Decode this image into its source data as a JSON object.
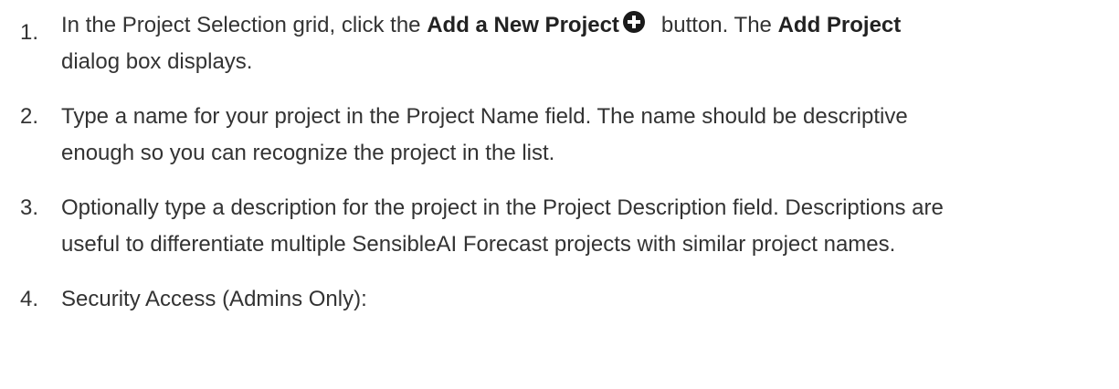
{
  "steps": [
    {
      "number": "1.",
      "text_before": "In the Project Selection grid, click the ",
      "bold_1": "Add a New Project",
      "icon": "plus-circle-icon",
      "text_middle": "button. The ",
      "bold_2": "Add Project",
      "line_2": "dialog box displays."
    },
    {
      "number": "2.",
      "line_1": "Type a name for your project in the Project Name field. The name should be descriptive",
      "line_2": "enough so you can recognize the project in the list."
    },
    {
      "number": "3.",
      "line_1": "Optionally type a description for the project in the Project Description field. Descriptions are",
      "line_2": "useful to differentiate multiple SensibleAI Forecast projects with similar project names."
    },
    {
      "number": "4.",
      "line_1": "Security Access (Admins Only):"
    }
  ]
}
